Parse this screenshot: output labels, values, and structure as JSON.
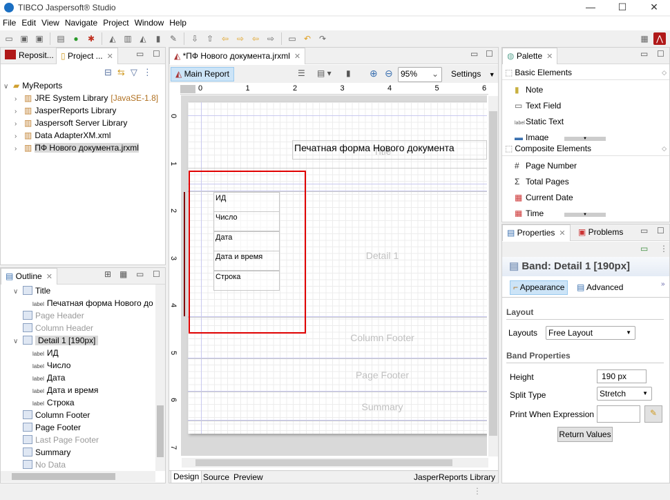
{
  "window": {
    "title": "TIBCO Jaspersoft® Studio",
    "minimize": "—",
    "maximize": "☐",
    "close": "✕"
  },
  "menu": [
    "File",
    "Edit",
    "View",
    "Navigate",
    "Project",
    "Window",
    "Help"
  ],
  "left_top": {
    "tabs": [
      {
        "label": "Reposit..."
      },
      {
        "label": "Project ..."
      }
    ],
    "tree": [
      {
        "label": "MyReports",
        "level": 0,
        "expanded": true
      },
      {
        "label": "JRE System Library",
        "suffix": "[JavaSE-1.8]",
        "level": 1
      },
      {
        "label": "JasperReports Library",
        "level": 1
      },
      {
        "label": "Jaspersoft Server Library",
        "level": 1
      },
      {
        "label": "Data AdapterXM.xml",
        "level": 1
      },
      {
        "label": "ПФ Нового документа.jrxml",
        "level": 1,
        "selected": true
      }
    ]
  },
  "outline": {
    "title": "Outline",
    "items": [
      {
        "label": "Title",
        "type": "band",
        "level": 0,
        "expanded": true
      },
      {
        "label": "Печатная форма Нового до",
        "type": "label",
        "level": 1
      },
      {
        "label": "Page Header",
        "type": "band",
        "level": 0,
        "disabled": true
      },
      {
        "label": "Column Header",
        "type": "band",
        "level": 0,
        "disabled": true
      },
      {
        "label": "Detail 1 [190px]",
        "type": "band",
        "level": 0,
        "expanded": true,
        "selected": true
      },
      {
        "label": "ИД",
        "type": "label",
        "level": 1
      },
      {
        "label": "Число",
        "type": "label",
        "level": 1
      },
      {
        "label": "Дата",
        "type": "label",
        "level": 1
      },
      {
        "label": "Дата и время",
        "type": "label",
        "level": 1
      },
      {
        "label": "Строка",
        "type": "label",
        "level": 1
      },
      {
        "label": "Column Footer",
        "type": "band",
        "level": 0
      },
      {
        "label": "Page Footer",
        "type": "band",
        "level": 0
      },
      {
        "label": "Last Page Footer",
        "type": "band",
        "level": 0,
        "disabled": true
      },
      {
        "label": "Summary",
        "type": "band",
        "level": 0
      },
      {
        "label": "No Data",
        "type": "band",
        "level": 0,
        "disabled": true
      }
    ],
    "label_icon": "label"
  },
  "editor": {
    "tab": "*ПФ Нового документа.jrxml",
    "main_report": "Main Report",
    "zoom": "95%",
    "settings": "Settings",
    "ruler": [
      "0",
      "1",
      "2",
      "3",
      "4",
      "5",
      "6"
    ],
    "vruler": [
      "0",
      "1",
      "2",
      "3",
      "4",
      "5",
      "6",
      "7"
    ],
    "title_text": "Печатная форма Нового документа",
    "bands": {
      "title": "Title",
      "detail": "Detail 1",
      "column_footer": "Column Footer",
      "page_footer": "Page Footer",
      "summary": "Summary"
    },
    "fields": [
      "ИД",
      "Число",
      "Дата",
      "Дата и время",
      "Строка"
    ],
    "bottom_tabs": [
      "Design",
      "Source",
      "Preview"
    ],
    "library": "JasperReports Library",
    "selection_color": "#e00000"
  },
  "palette": {
    "title": "Palette",
    "groups": [
      {
        "label": "Basic Elements",
        "items": [
          "Note",
          "Text Field",
          "Static Text",
          "Image"
        ]
      },
      {
        "label": "Composite Elements",
        "items": [
          "Page Number",
          "Total Pages",
          "Current Date",
          "Time"
        ]
      }
    ]
  },
  "properties": {
    "tabs": [
      "Properties",
      "Problems"
    ],
    "header": "Band: Detail 1 [190px]",
    "subtabs": [
      "Appearance",
      "Advanced"
    ],
    "layout_section": "Layout",
    "layouts_label": "Layouts",
    "layouts_value": "Free Layout",
    "band_section": "Band Properties",
    "height_label": "Height",
    "height_value": "190 px",
    "split_label": "Split Type",
    "split_value": "Stretch",
    "print_when_label": "Print When Expression",
    "print_when_value": "",
    "return_values": "Return Values"
  }
}
